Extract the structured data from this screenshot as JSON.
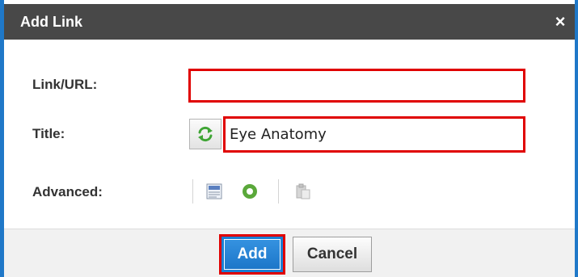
{
  "dialog": {
    "title": "Add Link",
    "close_symbol": "×",
    "close_icon": "close-icon"
  },
  "form": {
    "url": {
      "label": "Link/URL:",
      "value": ""
    },
    "title": {
      "label": "Title:",
      "value": "Eye Anatomy",
      "refresh_icon": "refresh-icon"
    },
    "advanced": {
      "label": "Advanced:",
      "icons": [
        "spellcheck-icon",
        "radio-circle-icon",
        "paste-icon"
      ]
    }
  },
  "buttons": {
    "add": "Add",
    "cancel": "Cancel"
  },
  "colors": {
    "titlebar": "#484848",
    "highlight": "#e00000",
    "primary": "#1a7fd4",
    "edge": "#1f78c8",
    "refresh_green": "#3fa535"
  }
}
